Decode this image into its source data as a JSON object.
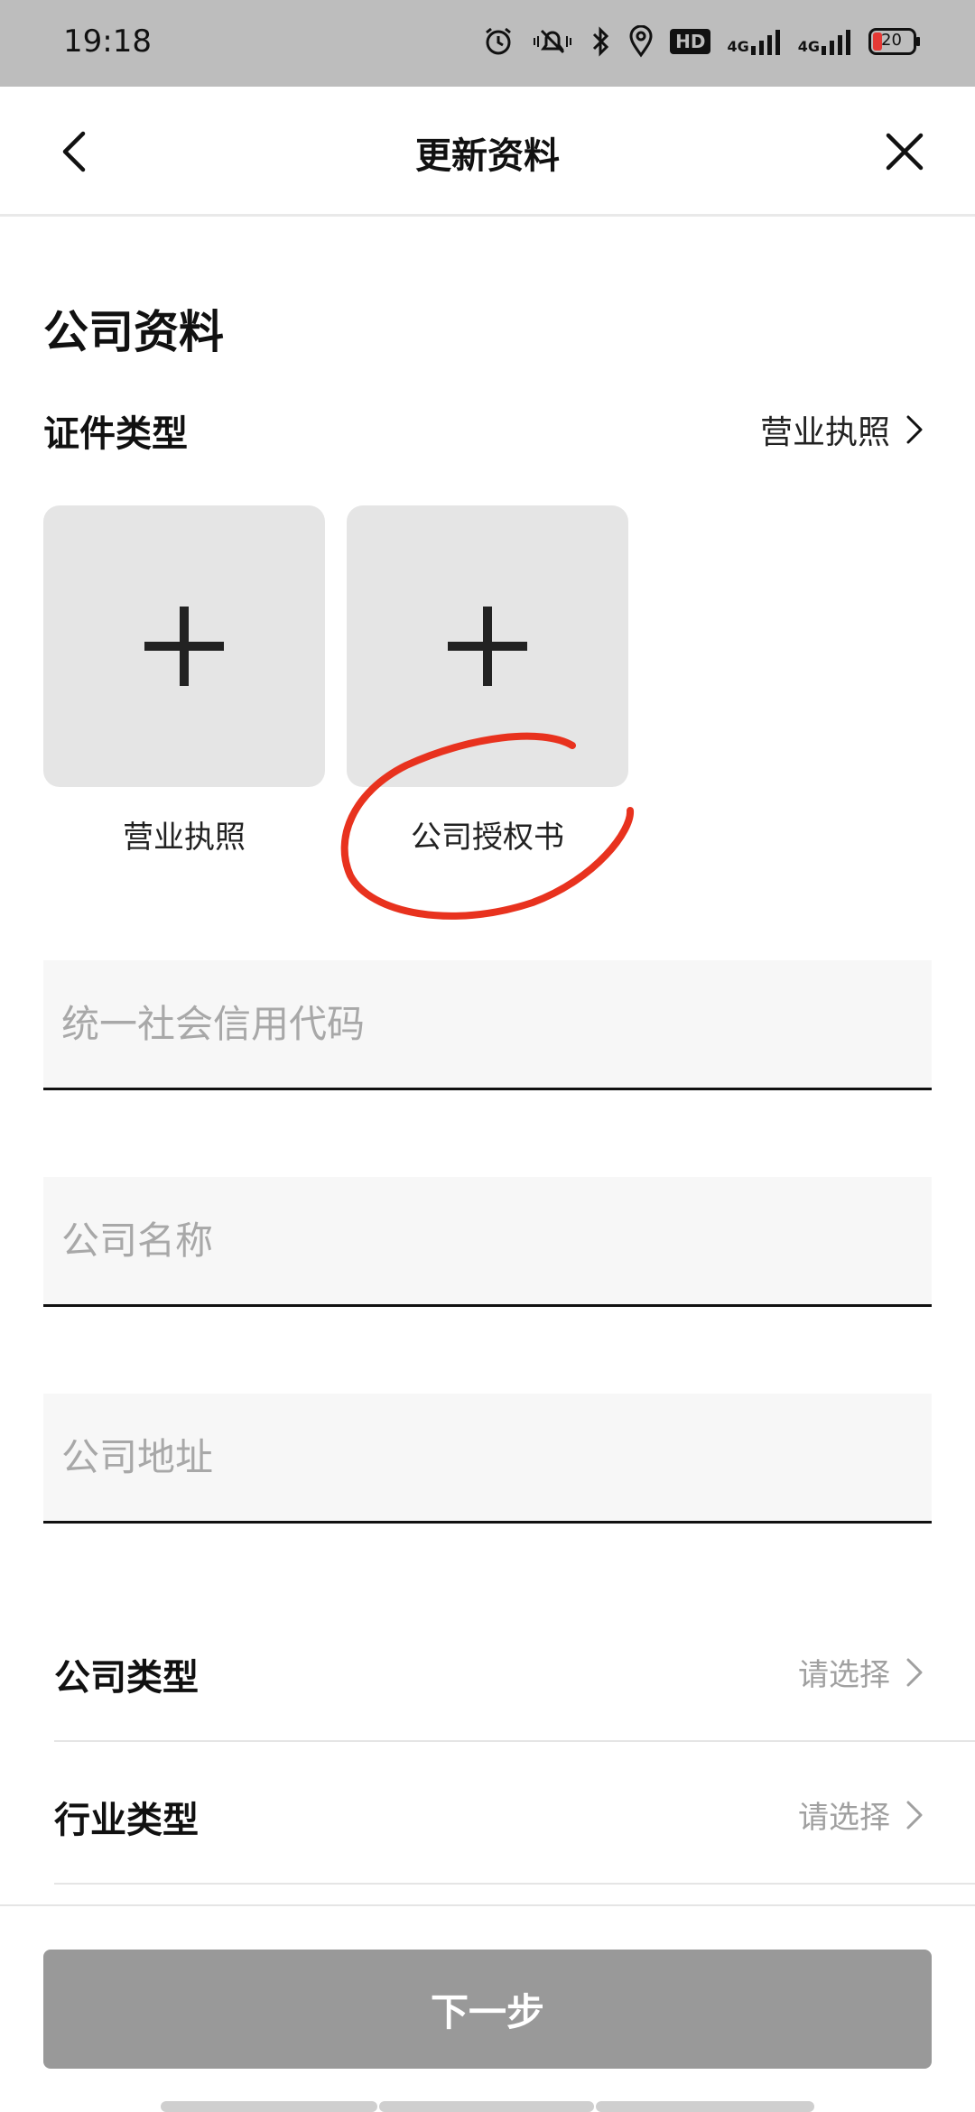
{
  "status_bar": {
    "time": "19:18",
    "hd_badge": "HD",
    "net1": "4G",
    "net2": "4G",
    "battery": "20",
    "icons": [
      "alarm-icon",
      "mute-icon",
      "bluetooth-icon",
      "location-icon",
      "hd-badge",
      "signal-icon",
      "signal-icon",
      "battery-icon"
    ]
  },
  "nav": {
    "title": "更新资料",
    "back_icon": "chevron-left-icon",
    "close_icon": "close-icon"
  },
  "section": {
    "title": "公司资料",
    "doc_type_label": "证件类型",
    "doc_type_value": "营业执照"
  },
  "uploads": [
    {
      "label": "营业执照",
      "icon": "plus-icon"
    },
    {
      "label": "公司授权书",
      "icon": "plus-icon"
    }
  ],
  "annotation_color": "#e8321e",
  "fields": [
    {
      "placeholder": "统一社会信用代码",
      "value": ""
    },
    {
      "placeholder": "公司名称",
      "value": ""
    },
    {
      "placeholder": "公司地址",
      "value": ""
    }
  ],
  "selects": [
    {
      "label": "公司类型",
      "value": "请选择"
    },
    {
      "label": "行业类型",
      "value": "请选择"
    }
  ],
  "next_button": {
    "label": "下一步"
  },
  "colors": {
    "status_bar_bg": "#bdbdbd",
    "tile_bg": "#e5e5e5",
    "field_bg": "#f7f7f7",
    "button_bg": "#999999",
    "placeholder": "#a8a8a8"
  }
}
